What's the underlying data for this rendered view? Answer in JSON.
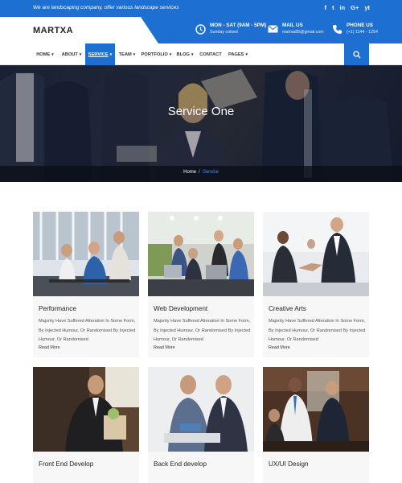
{
  "topbar": {
    "tagline": "We are landscaping company, offer various landscape services",
    "social": [
      "f",
      "t",
      "in",
      "G+",
      "yt"
    ]
  },
  "header": {
    "logo": "MARTXA",
    "hours": {
      "title": "MON - SAT (9AM - 5PM)",
      "sub": "Sunday colsed"
    },
    "mail": {
      "title": "MAIL US",
      "sub": "martxa85@gmail.com"
    },
    "phone": {
      "title": "PHONE US",
      "sub": "(+1) 1144 - 1254"
    }
  },
  "nav": {
    "items": [
      "HOME",
      "ABOUT",
      "SERVICE",
      "TEAM",
      "PORTFOLIO",
      "BLOG",
      "CONTACT",
      "PAGES"
    ],
    "active": "SERVICE"
  },
  "hero": {
    "title": "Service One",
    "breadcrumb": {
      "home": "Home",
      "separator": "/",
      "current": "Service"
    }
  },
  "services": [
    {
      "title": "Performance",
      "desc": "Majority Have Suffered Alteration In Some Form, By Injected Humour, Or Randomised By Injected Humour, Or Randomised",
      "more": "Read More"
    },
    {
      "title": "Web Development",
      "desc": "Majority Have Suffered Alteration In Some Form, By Injected Humour, Or Randomised By Injected Humour, Or Randomised",
      "more": "Read More"
    },
    {
      "title": "Creative Arts",
      "desc": "Majority Have Suffered Alteration In Some Form, By Injected Humour, Or Randomised By Injected Humour, Or Randomised",
      "more": "Read More"
    },
    {
      "title": "Front End Develop"
    },
    {
      "title": "Back End develop"
    },
    {
      "title": "UX/UI Design"
    }
  ],
  "colors": {
    "brand": "#1e6fd2",
    "dark": "#1a2233",
    "crumb_current": "#4a94f0"
  }
}
